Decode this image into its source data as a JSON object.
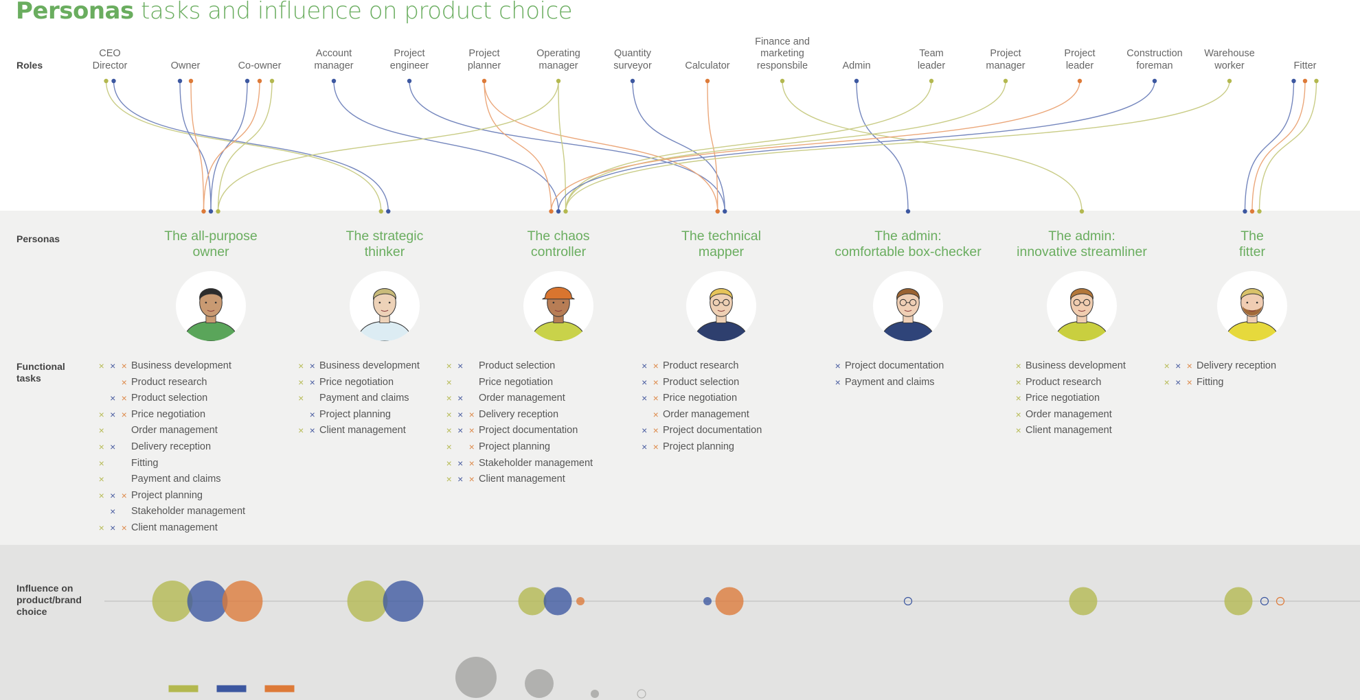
{
  "title": {
    "bold": "Personas",
    "rest": " tasks and influence on product choice"
  },
  "row_labels": {
    "roles": "Roles",
    "personas": "Personas",
    "tasks": "Functional\ntasks",
    "influence": "Influence on\nproduct/brand\nchoice"
  },
  "colors": {
    "green": "#b3b84f",
    "blue": "#3c57a0",
    "orange": "#dd7a38",
    "title_green": "#6aad5f"
  },
  "roles": [
    {
      "label": "CEO\nDirector",
      "dots": [
        "green",
        "blue"
      ]
    },
    {
      "label": "Owner",
      "dots": [
        "blue",
        "orange"
      ]
    },
    {
      "label": "Co-owner",
      "dots": [
        "blue",
        "orange",
        "green"
      ]
    },
    {
      "label": "Account\nmanager",
      "dots": [
        "blue"
      ]
    },
    {
      "label": "Project\nengineer",
      "dots": [
        "blue"
      ]
    },
    {
      "label": "Project\nplanner",
      "dots": [
        "orange"
      ]
    },
    {
      "label": "Operating\nmanager",
      "dots": [
        "green"
      ]
    },
    {
      "label": "Quantity\nsurveyor",
      "dots": [
        "blue"
      ]
    },
    {
      "label": "Calculator",
      "dots": [
        "orange"
      ]
    },
    {
      "label": "Finance and\nmarketing\nresponsbile",
      "dots": [
        "green"
      ]
    },
    {
      "label": "Admin",
      "dots": [
        "blue"
      ]
    },
    {
      "label": "Team\nleader",
      "dots": [
        "green"
      ]
    },
    {
      "label": "Project\nmanager",
      "dots": [
        "green"
      ]
    },
    {
      "label": "Project\nleader",
      "dots": [
        "orange"
      ]
    },
    {
      "label": "Construction\nforeman",
      "dots": [
        "blue"
      ]
    },
    {
      "label": "Warehouse\nworker",
      "dots": [
        "green"
      ]
    },
    {
      "label": "Fitter",
      "dots": [
        "blue",
        "orange",
        "green"
      ]
    }
  ],
  "links": [
    {
      "role": 0,
      "color": "green",
      "persona": 1
    },
    {
      "role": 0,
      "color": "blue",
      "persona": 1
    },
    {
      "role": 1,
      "color": "blue",
      "persona": 0
    },
    {
      "role": 1,
      "color": "orange",
      "persona": 0
    },
    {
      "role": 2,
      "color": "blue",
      "persona": 0
    },
    {
      "role": 2,
      "color": "orange",
      "persona": 0
    },
    {
      "role": 2,
      "color": "green",
      "persona": 0
    },
    {
      "role": 3,
      "color": "blue",
      "persona": 2
    },
    {
      "role": 4,
      "color": "blue",
      "persona": 3
    },
    {
      "role": 5,
      "color": "orange",
      "persona": 2
    },
    {
      "role": 5,
      "color": "orange",
      "persona": 3
    },
    {
      "role": 6,
      "color": "green",
      "persona": 0
    },
    {
      "role": 6,
      "color": "green",
      "persona": 2
    },
    {
      "role": 7,
      "color": "blue",
      "persona": 3
    },
    {
      "role": 8,
      "color": "orange",
      "persona": 3
    },
    {
      "role": 9,
      "color": "green",
      "persona": 5
    },
    {
      "role": 10,
      "color": "blue",
      "persona": 4
    },
    {
      "role": 11,
      "color": "green",
      "persona": 2
    },
    {
      "role": 12,
      "color": "green",
      "persona": 2
    },
    {
      "role": 13,
      "color": "orange",
      "persona": 2
    },
    {
      "role": 14,
      "color": "blue",
      "persona": 2
    },
    {
      "role": 15,
      "color": "green",
      "persona": 2
    },
    {
      "role": 16,
      "color": "blue",
      "persona": 6
    },
    {
      "role": 16,
      "color": "orange",
      "persona": 6
    },
    {
      "role": 16,
      "color": "green",
      "persona": 6
    }
  ],
  "personas": [
    {
      "name": "The all-purpose\nowner",
      "avatar": "man-green-jacket",
      "anchors": [
        "orange",
        "blue",
        "green"
      ],
      "tasks": [
        {
          "marks": [
            "green",
            "blue",
            "orange"
          ],
          "label": "Business development"
        },
        {
          "marks": [
            "",
            "",
            "orange"
          ],
          "label": "Product research"
        },
        {
          "marks": [
            "",
            "blue",
            "orange"
          ],
          "label": "Product selection"
        },
        {
          "marks": [
            "green",
            "blue",
            "orange"
          ],
          "label": "Price negotiation"
        },
        {
          "marks": [
            "green",
            "",
            ""
          ],
          "label": "Order management"
        },
        {
          "marks": [
            "green",
            "blue",
            ""
          ],
          "label": "Delivery reception"
        },
        {
          "marks": [
            "green",
            "",
            ""
          ],
          "label": "Fitting"
        },
        {
          "marks": [
            "green",
            "",
            ""
          ],
          "label": "Payment and claims"
        },
        {
          "marks": [
            "green",
            "blue",
            "orange"
          ],
          "label": "Project planning"
        },
        {
          "marks": [
            "",
            "blue",
            ""
          ],
          "label": "Stakeholder management"
        },
        {
          "marks": [
            "green",
            "blue",
            "orange"
          ],
          "label": "Client management"
        }
      ],
      "influence": {
        "green": "large",
        "blue": "large",
        "orange": "large"
      }
    },
    {
      "name": "The strategic\nthinker",
      "avatar": "man-blond-shirt",
      "anchors": [
        "green",
        "blue"
      ],
      "tasks": [
        {
          "marks": [
            "green",
            "blue"
          ],
          "label": "Business development"
        },
        {
          "marks": [
            "green",
            "blue"
          ],
          "label": "Price negotiation"
        },
        {
          "marks": [
            "green",
            ""
          ],
          "label": "Payment and claims"
        },
        {
          "marks": [
            "",
            "blue"
          ],
          "label": "Project planning"
        },
        {
          "marks": [
            "green",
            "blue"
          ],
          "label": "Client management"
        }
      ],
      "influence": {
        "green": "large",
        "blue": "large"
      }
    },
    {
      "name": "The chaos\ncontroller",
      "avatar": "man-hard-hat",
      "anchors": [
        "orange",
        "blue",
        "green"
      ],
      "tasks": [
        {
          "marks": [
            "green",
            "blue",
            ""
          ],
          "label": "Product selection"
        },
        {
          "marks": [
            "green",
            "",
            ""
          ],
          "label": "Price negotiation"
        },
        {
          "marks": [
            "green",
            "blue",
            ""
          ],
          "label": "Order management"
        },
        {
          "marks": [
            "green",
            "blue",
            "orange"
          ],
          "label": "Delivery reception"
        },
        {
          "marks": [
            "green",
            "blue",
            "orange"
          ],
          "label": "Project documentation"
        },
        {
          "marks": [
            "green",
            "",
            "orange"
          ],
          "label": "Project planning"
        },
        {
          "marks": [
            "green",
            "blue",
            "orange"
          ],
          "label": "Stakeholder management"
        },
        {
          "marks": [
            "green",
            "blue",
            "orange"
          ],
          "label": "Client management"
        }
      ],
      "influence": {
        "green": "medium",
        "blue": "medium",
        "orange": "small"
      }
    },
    {
      "name": "The technical\nmapper",
      "avatar": "man-glasses-navy",
      "anchors": [
        "orange",
        "blue"
      ],
      "tasks": [
        {
          "marks": [
            "blue",
            "orange"
          ],
          "label": "Product research"
        },
        {
          "marks": [
            "blue",
            "orange"
          ],
          "label": "Product selection"
        },
        {
          "marks": [
            "blue",
            "orange"
          ],
          "label": "Price negotiation"
        },
        {
          "marks": [
            "",
            "orange"
          ],
          "label": "Order management"
        },
        {
          "marks": [
            "blue",
            "orange"
          ],
          "label": "Project documentation"
        },
        {
          "marks": [
            "blue",
            "orange"
          ],
          "label": "Project planning"
        }
      ],
      "influence": {
        "blue": "small",
        "orange": "medium"
      }
    },
    {
      "name": "The admin:\ncomfortable box-checker",
      "avatar": "woman-glasses-navy",
      "anchors": [
        "blue"
      ],
      "tasks": [
        {
          "marks": [
            "blue"
          ],
          "label": "Project documentation"
        },
        {
          "marks": [
            "blue"
          ],
          "label": "Payment and claims"
        }
      ],
      "influence": {
        "blue": "none"
      }
    },
    {
      "name": "The admin:\ninnovative streamliner",
      "avatar": "woman-glasses-yellow",
      "anchors": [
        "green"
      ],
      "tasks": [
        {
          "marks": [
            "green"
          ],
          "label": "Business development"
        },
        {
          "marks": [
            "green"
          ],
          "label": "Product research"
        },
        {
          "marks": [
            "green"
          ],
          "label": "Price negotiation"
        },
        {
          "marks": [
            "green"
          ],
          "label": "Order management"
        },
        {
          "marks": [
            "green"
          ],
          "label": "Client management"
        }
      ],
      "influence": {
        "green": "medium"
      }
    },
    {
      "name": "The\nfitter",
      "avatar": "man-beard-yellow",
      "anchors": [
        "blue",
        "orange",
        "green"
      ],
      "tasks": [
        {
          "marks": [
            "green",
            "blue",
            "orange"
          ],
          "label": "Delivery reception"
        },
        {
          "marks": [
            "green",
            "blue",
            "orange"
          ],
          "label": "Fitting"
        }
      ],
      "influence": {
        "green": "medium",
        "blue": "none",
        "orange": "none"
      }
    }
  ],
  "legend": {
    "swatches": [
      "green",
      "blue",
      "orange"
    ],
    "sizes": [
      "large",
      "medium",
      "small",
      "none"
    ]
  }
}
